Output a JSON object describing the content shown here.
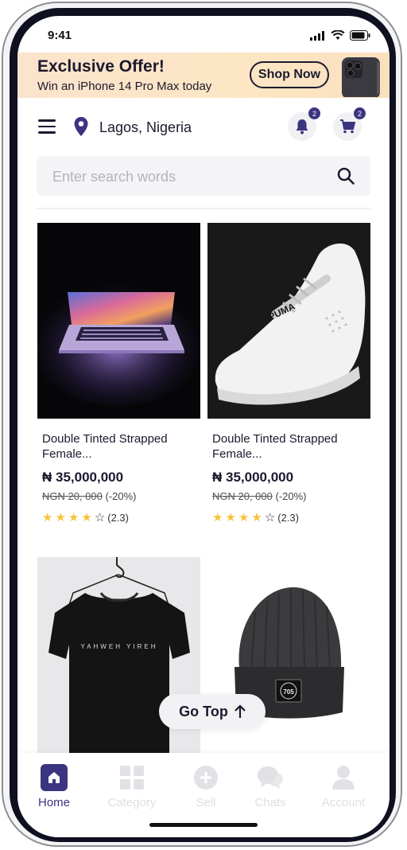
{
  "status": {
    "time": "9:41"
  },
  "banner": {
    "title": "Exclusive Offer!",
    "subtitle": "Win an iPhone 14 Pro Max today",
    "button_label": "Shop Now"
  },
  "header": {
    "location": "Lagos, Nigeria",
    "notifications_count": "2",
    "cart_count": "2"
  },
  "search": {
    "placeholder": "Enter search words",
    "value": ""
  },
  "products": [
    {
      "name": "Double Tinted Strapped Female...",
      "price": "₦ 35,000,000",
      "old_price": "NGN 20, 000",
      "discount": "(-20%)",
      "rating": "(2.3)",
      "stars": 4,
      "image": "laptop"
    },
    {
      "name": "Double Tinted Strapped Female...",
      "price": "₦ 35,000,000",
      "old_price": "NGN 20, 000",
      "discount": "(-20%)",
      "rating": "(2.3)",
      "stars": 4,
      "image": "sneaker"
    },
    {
      "image": "tshirt",
      "shirt_text": "YAHWEH YIREH"
    },
    {
      "image": "beanie",
      "beanie_text": "705"
    }
  ],
  "go_top": {
    "label": "Go Top"
  },
  "tabs": [
    {
      "label": "Home",
      "icon": "home-icon",
      "active": true
    },
    {
      "label": "Category",
      "icon": "grid-icon",
      "active": false
    },
    {
      "label": "Sell",
      "icon": "plus-circle-icon",
      "active": false
    },
    {
      "label": "Chats",
      "icon": "chat-icon",
      "active": false
    },
    {
      "label": "Account",
      "icon": "user-icon",
      "active": false
    }
  ],
  "colors": {
    "accent": "#3b3480",
    "banner_bg": "#fbe3cc",
    "star": "#f5c33b",
    "dark": "#1b1a2e"
  }
}
